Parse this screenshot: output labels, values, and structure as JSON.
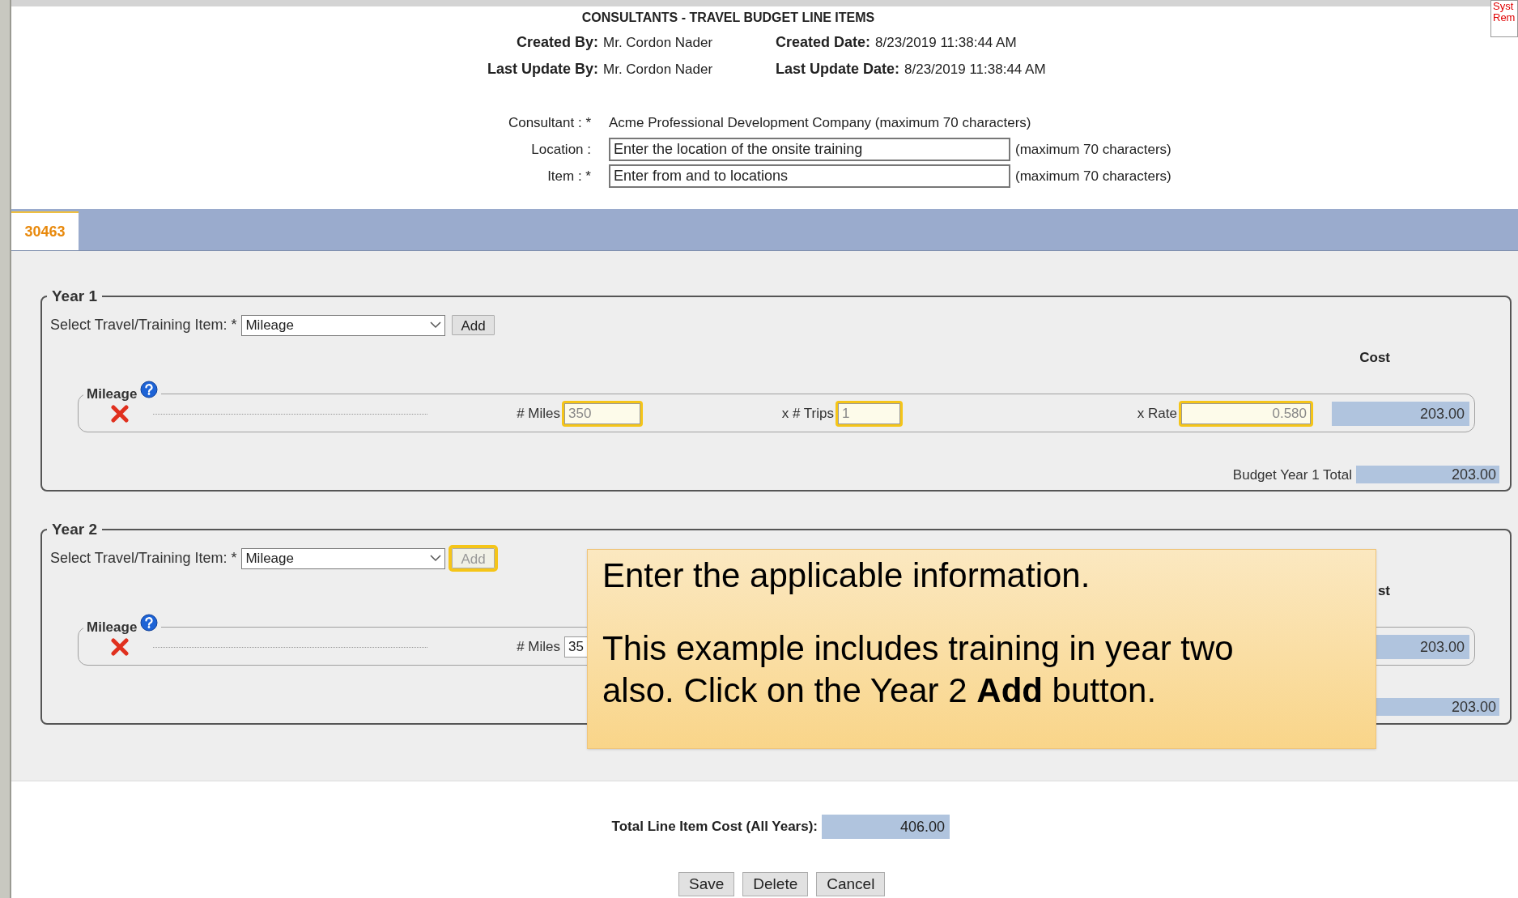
{
  "header": {
    "title": "CONSULTANTS - TRAVEL BUDGET LINE ITEMS",
    "corner_note": [
      "Syst",
      "Rem"
    ],
    "info": [
      {
        "label": "Created By:",
        "value": "Mr. Cordon Nader",
        "label2": "Created Date:",
        "value2": "8/23/2019 11:38:44 AM"
      },
      {
        "label": "Last Update By:",
        "value": "Mr. Cordon Nader",
        "label2": "Last Update Date:",
        "value2": "8/23/2019 11:38:44 AM"
      }
    ]
  },
  "form": {
    "consultant": {
      "label": "Consultant : *",
      "value": "Acme Professional Development Company (maximum 70 characters)"
    },
    "fields": [
      {
        "label": "Location :",
        "value": "Enter the location of the onsite training",
        "hint": "(maximum 70 characters)"
      },
      {
        "label": "Item : *",
        "value": "Enter from and to locations",
        "hint": "(maximum 70 characters)"
      }
    ]
  },
  "tab": {
    "label": "30463",
    "selected": true
  },
  "years": [
    {
      "legend": "Year 1",
      "select_label": "Select Travel/Training Item: *",
      "select_value": "Mileage",
      "add": {
        "label": "Add",
        "disabled": false,
        "highlighted": false
      },
      "cost_header": "Cost",
      "items": [
        {
          "legend": "Mileage",
          "fields": [
            {
              "label": "# Miles",
              "value": "350",
              "highlighted": true
            },
            {
              "label": "x # Trips",
              "value": "1",
              "highlighted": true
            },
            {
              "label": "x Rate",
              "value": "0.580",
              "highlighted": true
            }
          ],
          "cost": "203.00"
        }
      ],
      "total_label": "Budget Year 1 Total",
      "total": "203.00"
    },
    {
      "legend": "Year 2",
      "select_label": "Select Travel/Training Item: *",
      "select_value": "Mileage",
      "add": {
        "label": "Add",
        "disabled": true,
        "highlighted": true
      },
      "cost_header": "st",
      "items": [
        {
          "legend": "Mileage",
          "fields": [
            {
              "label": "# Miles",
              "value": "35",
              "highlighted": false
            }
          ],
          "cost": "203.00"
        }
      ],
      "total": "203.00"
    }
  ],
  "total_line": {
    "label": "Total Line Item Cost (All Years):",
    "value": "406.00"
  },
  "buttons": [
    "Save",
    "Delete",
    "Cancel"
  ],
  "callout": {
    "paragraphs": [
      "Enter the applicable information.",
      "This example includes training in year two also. Click on the Year 2 **Add** button."
    ]
  }
}
